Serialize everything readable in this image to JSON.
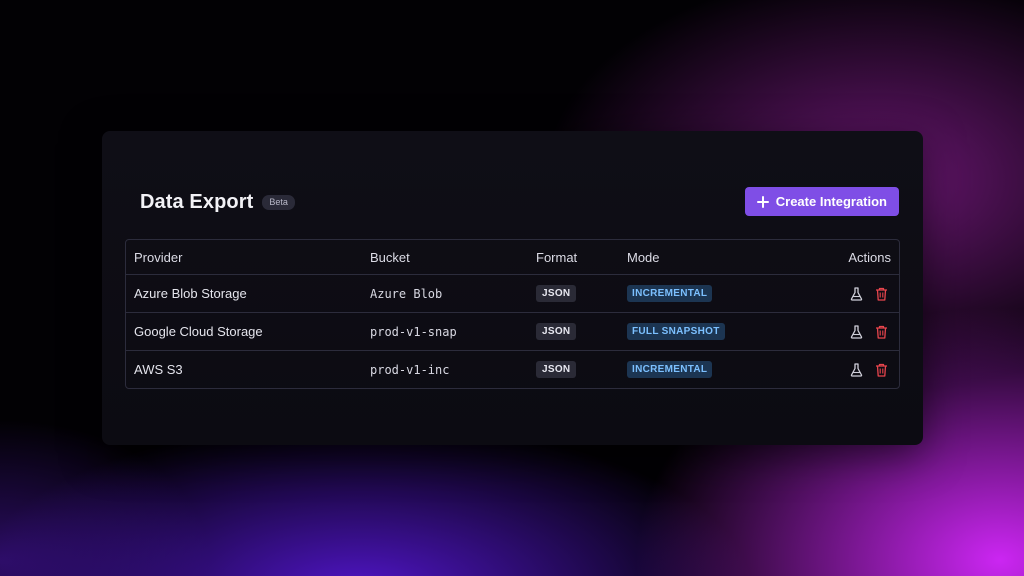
{
  "header": {
    "title": "Data Export",
    "badge": "Beta",
    "create_button_label": "Create Integration"
  },
  "table": {
    "columns": {
      "provider": "Provider",
      "bucket": "Bucket",
      "format": "Format",
      "mode": "Mode",
      "actions": "Actions"
    },
    "rows": [
      {
        "provider": "Azure Blob Storage",
        "bucket": "Azure Blob",
        "format": "JSON",
        "mode": "INCREMENTAL"
      },
      {
        "provider": "Google Cloud Storage",
        "bucket": "prod-v1-snap",
        "format": "JSON",
        "mode": "FULL SNAPSHOT"
      },
      {
        "provider": "AWS S3",
        "bucket": "prod-v1-inc",
        "format": "JSON",
        "mode": "INCREMENTAL"
      }
    ]
  },
  "icons": {
    "test": "flask-icon",
    "delete": "trash-icon",
    "add": "plus-icon"
  },
  "colors": {
    "accent": "#7f4ee6",
    "mode_badge_text": "#7cc0ff",
    "delete_icon": "#e8454d"
  }
}
